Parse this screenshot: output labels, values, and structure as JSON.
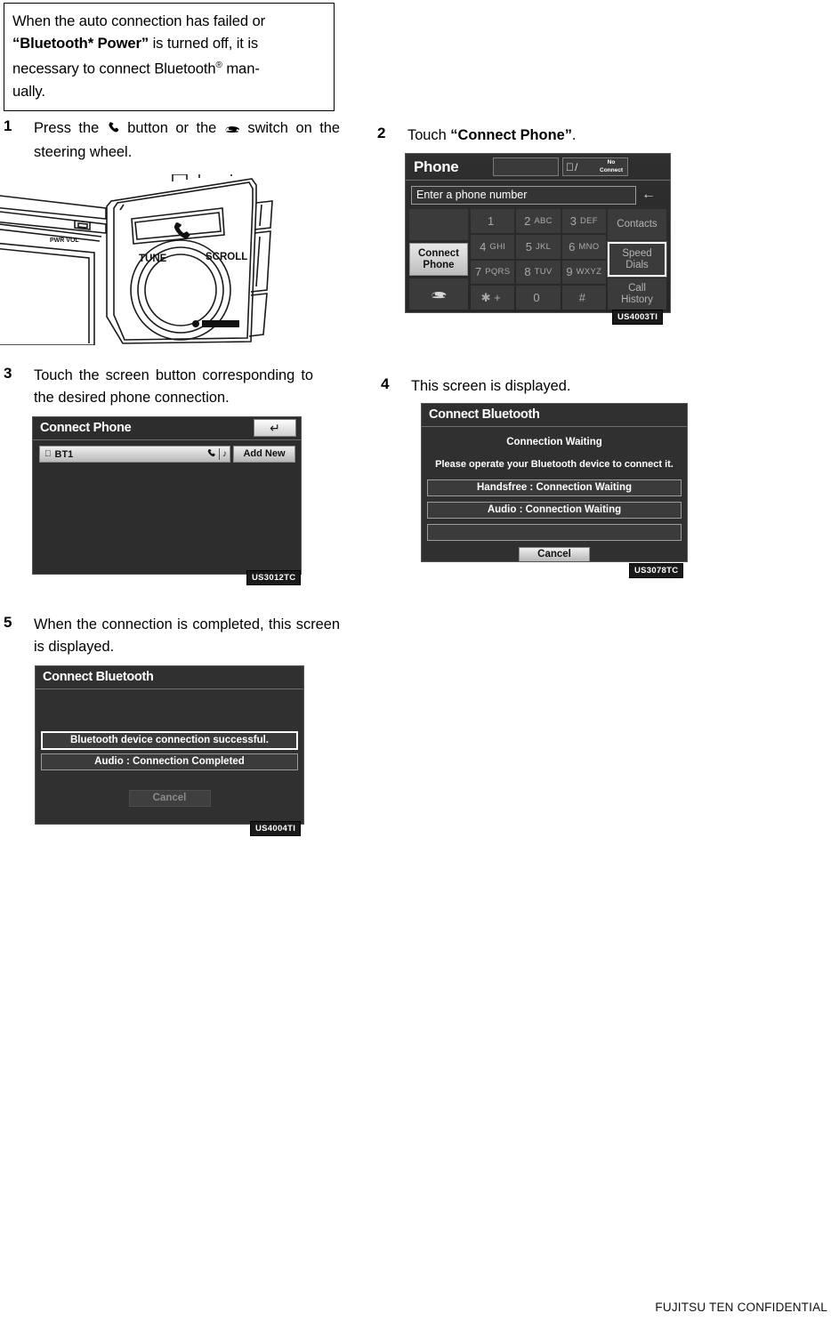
{
  "notice": {
    "line1": "When the auto connection has failed or",
    "bold_term": "“Bluetooth* Power”",
    "line2_rest": " is turned off, it is",
    "line3_a": "necessary to connect Bluetooth",
    "line3_sup": "®",
    "line3_b": " man-",
    "line4": "ually."
  },
  "steps": [
    {
      "num": "1",
      "text_a": "Press the ",
      "icon_1": "phone-handset-icon",
      "text_b": " button or the ",
      "icon_2": "off-hook-phone-icon",
      "text_c": " switch on the steering wheel."
    },
    {
      "num": "2",
      "text_a": "Touch ",
      "bold": "“Connect Phone”",
      "text_c": "."
    },
    {
      "num": "3",
      "text_a": "Touch the screen button corresponding to the desired phone connection."
    },
    {
      "num": "4",
      "text_a": "This screen is displayed."
    },
    {
      "num": "5",
      "text_a": "When the connection is completed, this screen is displayed."
    }
  ],
  "illustration": {
    "name": "audio-head-unit-illustration",
    "label_tune": "TUNE",
    "label_scroll": "SCROLL",
    "label_power": "PWR VOL",
    "phone_button_icon": "phone-handset-icon"
  },
  "phone_screen": {
    "code": "US4003TI",
    "title": "Phone",
    "status": {
      "bt_icon": "bluetooth-icon",
      "separator": "/",
      "no_connect": "No\nConnect",
      "no_connect_line1": "No",
      "no_connect_line2": "Connect"
    },
    "number_field_placeholder": "Enter a phone number",
    "backspace_icon": "backspace-arrow-icon",
    "keys": [
      {
        "digit": "1",
        "letters": ""
      },
      {
        "digit": "2",
        "letters": "ABC"
      },
      {
        "digit": "3",
        "letters": "DEF"
      },
      {
        "digit": "4",
        "letters": "GHI"
      },
      {
        "digit": "5",
        "letters": "JKL"
      },
      {
        "digit": "6",
        "letters": "MNO"
      },
      {
        "digit": "7",
        "letters": "PQRS"
      },
      {
        "digit": "8",
        "letters": "TUV"
      },
      {
        "digit": "9",
        "letters": "WXYZ"
      },
      {
        "digit": "✱ +",
        "letters": ""
      },
      {
        "digit": "0",
        "letters": ""
      },
      {
        "digit": "#",
        "letters": ""
      }
    ],
    "left_buttons": {
      "blank_top": "",
      "connect_phone_line1": "Connect",
      "connect_phone_line2": "Phone",
      "hangup_icon": "hangup-phone-icon"
    },
    "right_buttons": [
      {
        "label": "Contacts",
        "highlighted": false
      },
      {
        "label_line1": "Speed",
        "label_line2": "Dials",
        "highlighted": true
      },
      {
        "label_line1": "Call",
        "label_line2": "History",
        "highlighted": false
      }
    ]
  },
  "connect_phone_screen": {
    "code": "US3012TC",
    "title": "Connect Phone",
    "back_icon": "back-arrow-icon",
    "device": {
      "bt_icon": "bluetooth-icon",
      "name": "BT1",
      "phone_icon": "phone-handset-icon",
      "audio_icon": "music-note-icon"
    },
    "add_new_label": "Add New"
  },
  "connect_bluetooth_waiting": {
    "code": "US3078TC",
    "title": "Connect Bluetooth",
    "status_line": "Connection Waiting",
    "instruction": "Please operate your Bluetooth device to connect it.",
    "bars": [
      "Handsfree : Connection Waiting",
      "Audio : Connection Waiting",
      ""
    ],
    "cancel_label": "Cancel"
  },
  "connect_bluetooth_done": {
    "code": "US4004TI",
    "title": "Connect Bluetooth",
    "bars": [
      "Bluetooth device connection successful.",
      "Audio : Connection Completed"
    ],
    "cancel_label": "Cancel"
  },
  "footer": {
    "text": "FUJITSU TEN CONFIDENTIAL"
  },
  "colors": {
    "page_bg": "#ffffff",
    "screen_bg": "#2d2d2d",
    "key_bg": "#3b3b3b",
    "highlight": "#ffffff",
    "text": "#000000"
  }
}
